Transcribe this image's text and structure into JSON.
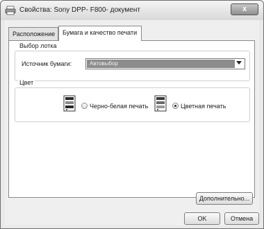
{
  "window": {
    "title": "Свойства: Sony DPP- F800- документ",
    "close_label": "x"
  },
  "tabs": [
    {
      "label": "Расположение"
    },
    {
      "label": "Бумага и качество печати"
    }
  ],
  "tray_group": {
    "label": "Выбор лотка",
    "source_label": "Источник бумаги:",
    "source_value": "Автовыбор"
  },
  "color_group": {
    "label": "Цвет",
    "options": [
      {
        "label": "Черно-белая печать",
        "selected": false
      },
      {
        "label": "Цветная печать",
        "selected": true
      }
    ]
  },
  "buttons": {
    "advanced": "Дополнительно...",
    "ok": "OK",
    "cancel": "Отмена"
  }
}
